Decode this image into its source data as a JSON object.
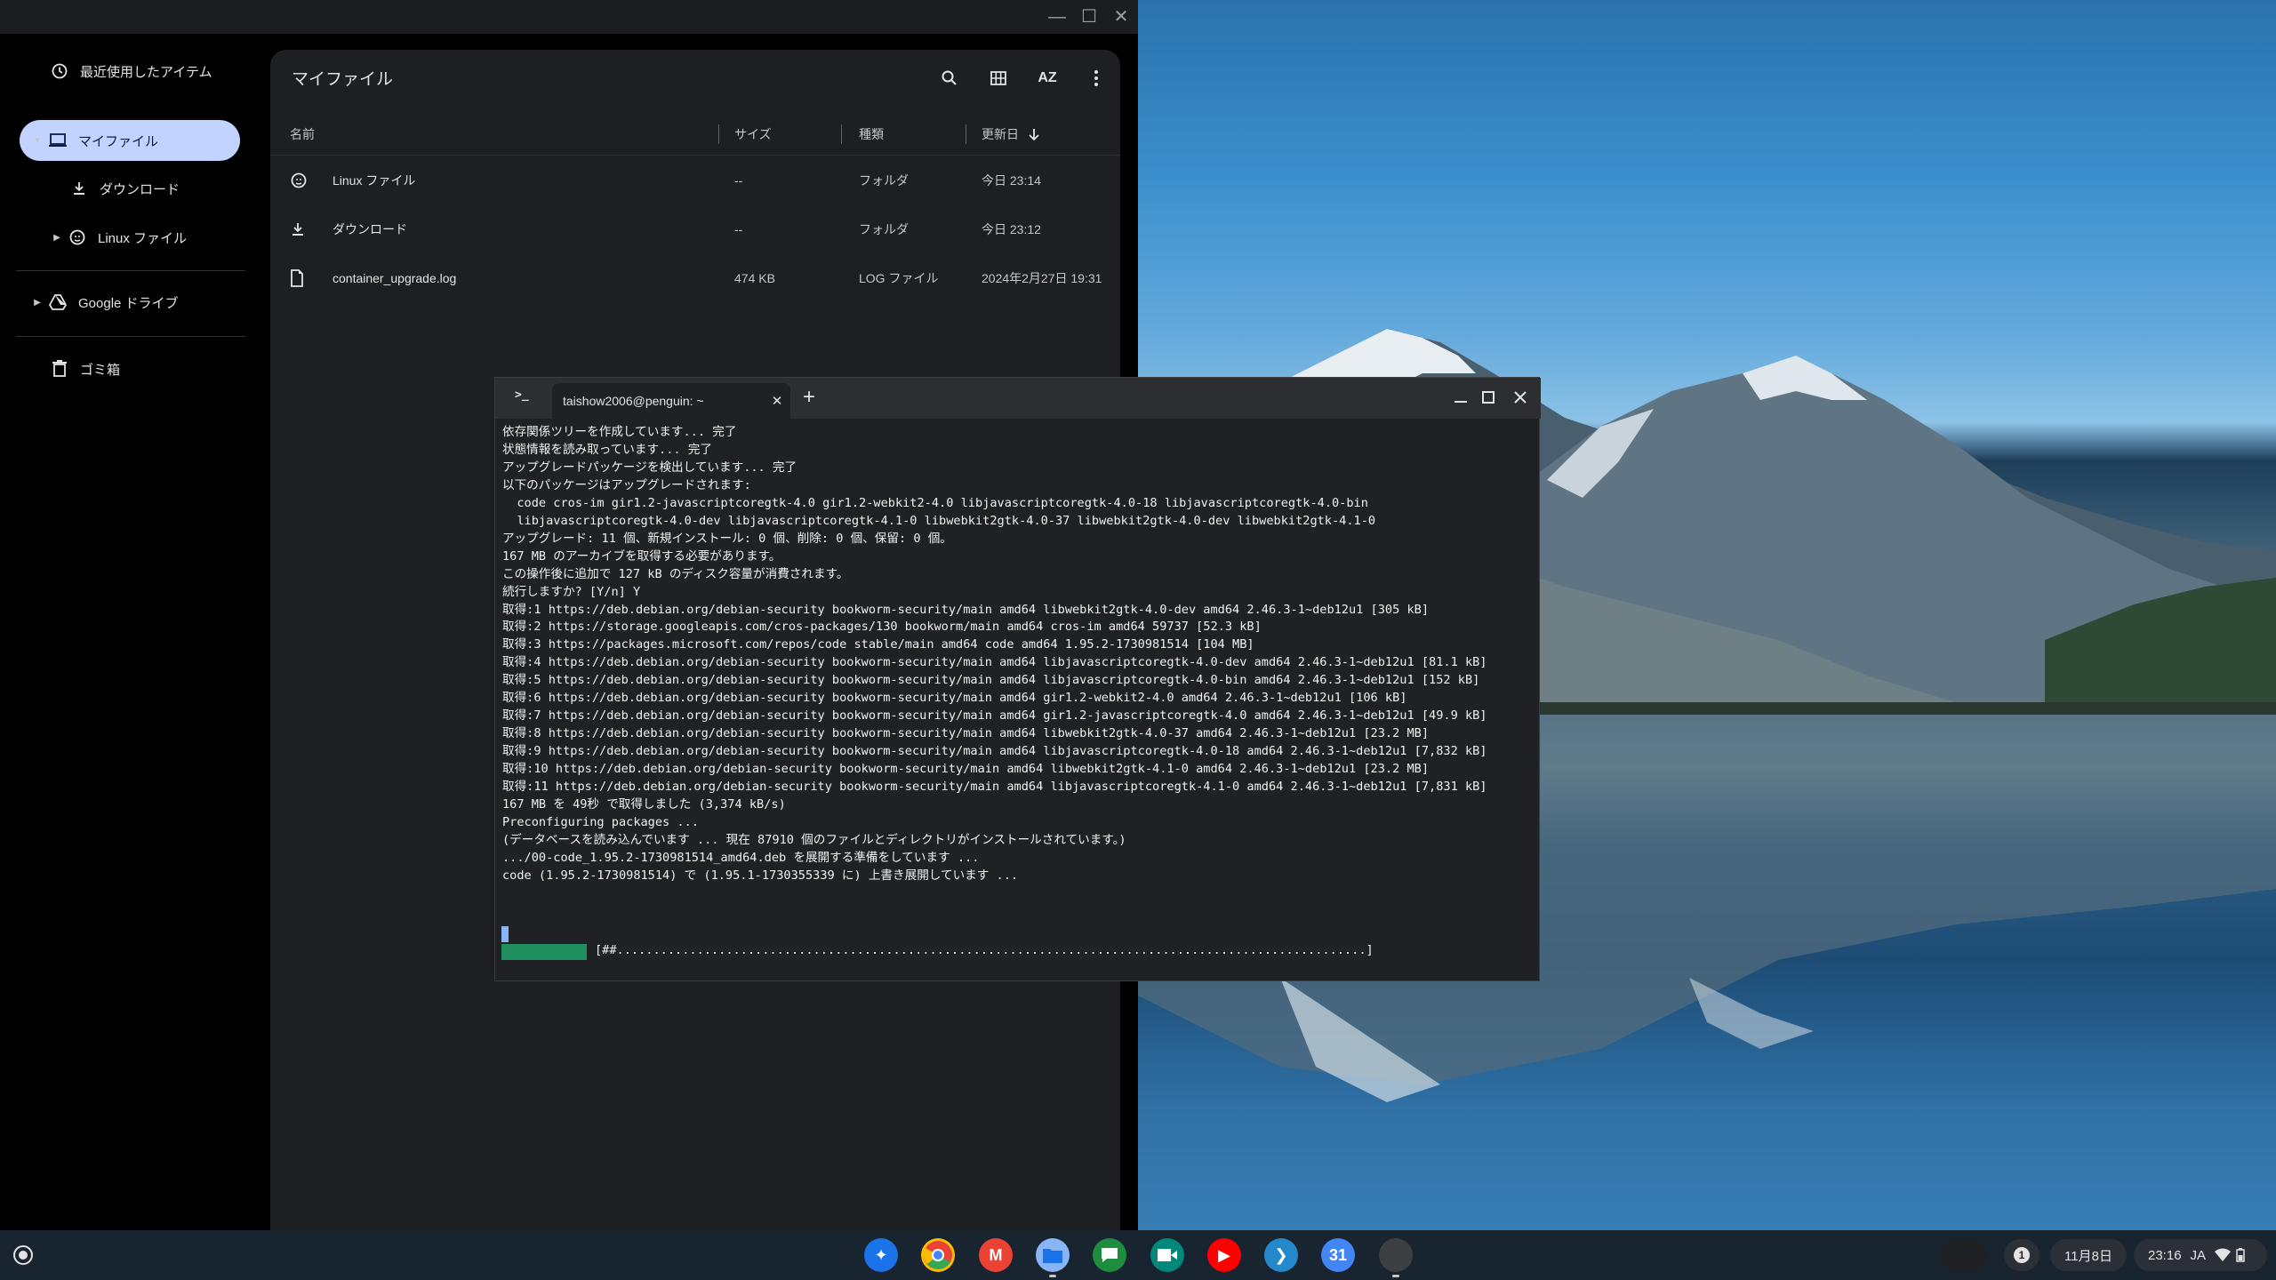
{
  "files": {
    "window_controls": {
      "minimize": "—",
      "maximize": "☐",
      "close": "✕"
    },
    "sidebar": {
      "recent": "最近使用したアイテム",
      "my_files": "マイファイル",
      "downloads": "ダウンロード",
      "linux_files": "Linux ファイル",
      "google_drive": "Google ドライブ",
      "trash": "ゴミ箱"
    },
    "main": {
      "title": "マイファイル",
      "sort_label": "AZ",
      "columns": {
        "name": "名前",
        "size": "サイズ",
        "type": "種類",
        "modified": "更新日"
      },
      "rows": [
        {
          "name": "Linux ファイル",
          "size": "--",
          "type": "フォルダ",
          "modified": "今日 23:14",
          "icon": "linux-folder-icon"
        },
        {
          "name": "ダウンロード",
          "size": "--",
          "type": "フォルダ",
          "modified": "今日 23:12",
          "icon": "download-folder-icon"
        },
        {
          "name": "container_upgrade.log",
          "size": "474 KB",
          "type": "LOG ファイル",
          "modified": "2024年2月27日 19:31",
          "icon": "file-icon"
        }
      ]
    }
  },
  "terminal": {
    "tab_title": "taishow2006@penguin: ~",
    "prompt_glyph": ">_",
    "new_tab": "+",
    "output": "依存関係ツリーを作成しています... 完了\n状態情報を読み取っています... 完了\nアップグレードパッケージを検出しています... 完了\n以下のパッケージはアップグレードされます:\n  code cros-im gir1.2-javascriptcoregtk-4.0 gir1.2-webkit2-4.0 libjavascriptcoregtk-4.0-18 libjavascriptcoregtk-4.0-bin\n  libjavascriptcoregtk-4.0-dev libjavascriptcoregtk-4.1-0 libwebkit2gtk-4.0-37 libwebkit2gtk-4.0-dev libwebkit2gtk-4.1-0\nアップグレード: 11 個、新規インストール: 0 個、削除: 0 個、保留: 0 個。\n167 MB のアーカイブを取得する必要があります。\nこの操作後に追加で 127 kB のディスク容量が消費されます。\n続行しますか? [Y/n] Y\n取得:1 https://deb.debian.org/debian-security bookworm-security/main amd64 libwebkit2gtk-4.0-dev amd64 2.46.3-1~deb12u1 [305 kB]\n取得:2 https://storage.googleapis.com/cros-packages/130 bookworm/main amd64 cros-im amd64 59737 [52.3 kB]\n取得:3 https://packages.microsoft.com/repos/code stable/main amd64 code amd64 1.95.2-1730981514 [104 MB]\n取得:4 https://deb.debian.org/debian-security bookworm-security/main amd64 libjavascriptcoregtk-4.0-dev amd64 2.46.3-1~deb12u1 [81.1 kB]\n取得:5 https://deb.debian.org/debian-security bookworm-security/main amd64 libjavascriptcoregtk-4.0-bin amd64 2.46.3-1~deb12u1 [152 kB]\n取得:6 https://deb.debian.org/debian-security bookworm-security/main amd64 gir1.2-webkit2-4.0 amd64 2.46.3-1~deb12u1 [106 kB]\n取得:7 https://deb.debian.org/debian-security bookworm-security/main amd64 gir1.2-javascriptcoregtk-4.0 amd64 2.46.3-1~deb12u1 [49.9 kB]\n取得:8 https://deb.debian.org/debian-security bookworm-security/main amd64 libwebkit2gtk-4.0-37 amd64 2.46.3-1~deb12u1 [23.2 MB]\n取得:9 https://deb.debian.org/debian-security bookworm-security/main amd64 libjavascriptcoregtk-4.0-18 amd64 2.46.3-1~deb12u1 [7,832 kB]\n取得:10 https://deb.debian.org/debian-security bookworm-security/main amd64 libwebkit2gtk-4.1-0 amd64 2.46.3-1~deb12u1 [23.2 MB]\n取得:11 https://deb.debian.org/debian-security bookworm-security/main amd64 libjavascriptcoregtk-4.1-0 amd64 2.46.3-1~deb12u1 [7,831 kB]\n167 MB を 49秒 で取得しました (3,374 kB/s)\nPreconfiguring packages ...\n(データベースを読み込んでいます ... 現在 87910 個のファイルとディレクトリがインストールされています。)\n.../00-code_1.95.2-1730981514_amd64.deb を展開する準備をしています ...\ncode (1.95.2-1730981514) で (1.95.1-1730355339 に) 上書き展開しています ...",
    "progress_text": "[##.......................................................................................................]",
    "progress_fraction": 0.02
  },
  "shelf": {
    "apps": [
      {
        "name": "gemini-icon",
        "glyph": "✦",
        "color": "#ffffff"
      },
      {
        "name": "chrome-icon",
        "glyph": "",
        "color": "#ffffff"
      },
      {
        "name": "gmail-icon",
        "glyph": "M",
        "color": "#ffffff"
      },
      {
        "name": "files-icon",
        "glyph": "",
        "color": "#1a73e8"
      },
      {
        "name": "chat-icon",
        "glyph": "",
        "color": "#ffffff"
      },
      {
        "name": "meet-icon",
        "glyph": "",
        "color": "#ffffff"
      },
      {
        "name": "youtube-icon",
        "glyph": "▶",
        "color": "#ffffff"
      },
      {
        "name": "vscode-icon",
        "glyph": "❯",
        "color": "#ffffff"
      },
      {
        "name": "calendar-icon",
        "glyph": "31",
        "color": "#ffffff"
      },
      {
        "name": "terminal-icon",
        "glyph": ">_",
        "color": "#3c4043"
      }
    ],
    "tray": {
      "notification_count": "1",
      "date": "11月8日",
      "time": "23:16",
      "ime": "JA"
    }
  }
}
